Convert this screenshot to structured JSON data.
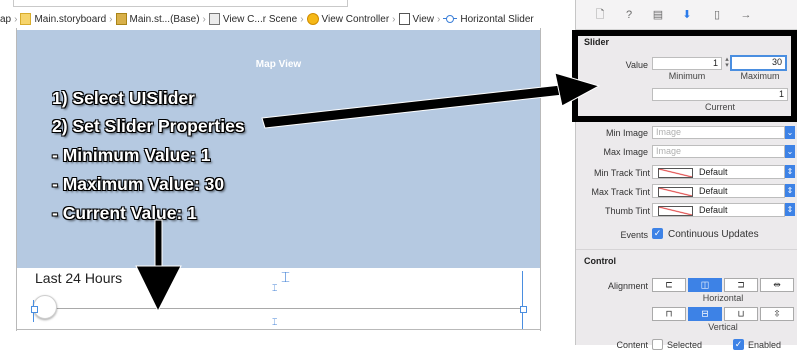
{
  "jumpbar": {
    "items": [
      "ap",
      "Main.storyboard",
      "Main.st...(Base)",
      "View C...r Scene",
      "View Controller",
      "View",
      "Horizontal Slider"
    ]
  },
  "canvas": {
    "map_title": "Map View",
    "label": "Last 24 Hours"
  },
  "annotation": {
    "steps": [
      "1) Select UISlider",
      "2) Set Slider Properties",
      "- Minimum Value: 1",
      "- Maximum Value: 30",
      "- Current Value: 1"
    ]
  },
  "inspector": {
    "slider_section": "Slider",
    "value_label": "Value",
    "minimum_value": "1",
    "maximum_value": "30",
    "minimum_caption": "Minimum",
    "maximum_caption": "Maximum",
    "current_value": "1",
    "current_caption": "Current",
    "min_image_label": "Min Image",
    "max_image_label": "Max Image",
    "image_placeholder": "Image",
    "min_track_label": "Min Track Tint",
    "max_track_label": "Max Track Tint",
    "thumb_tint_label": "Thumb Tint",
    "default_text": "Default",
    "events_label": "Events",
    "continuous_updates": "Continuous Updates",
    "control_section": "Control",
    "alignment_label": "Alignment",
    "horizontal_caption": "Horizontal",
    "vertical_caption": "Vertical",
    "content_label": "Content",
    "selected_label": "Selected",
    "enabled_label": "Enabled"
  },
  "colors": {
    "map_bg": "#b5c9e1",
    "accent": "#3d82e6",
    "annotation_black": "#000000"
  }
}
